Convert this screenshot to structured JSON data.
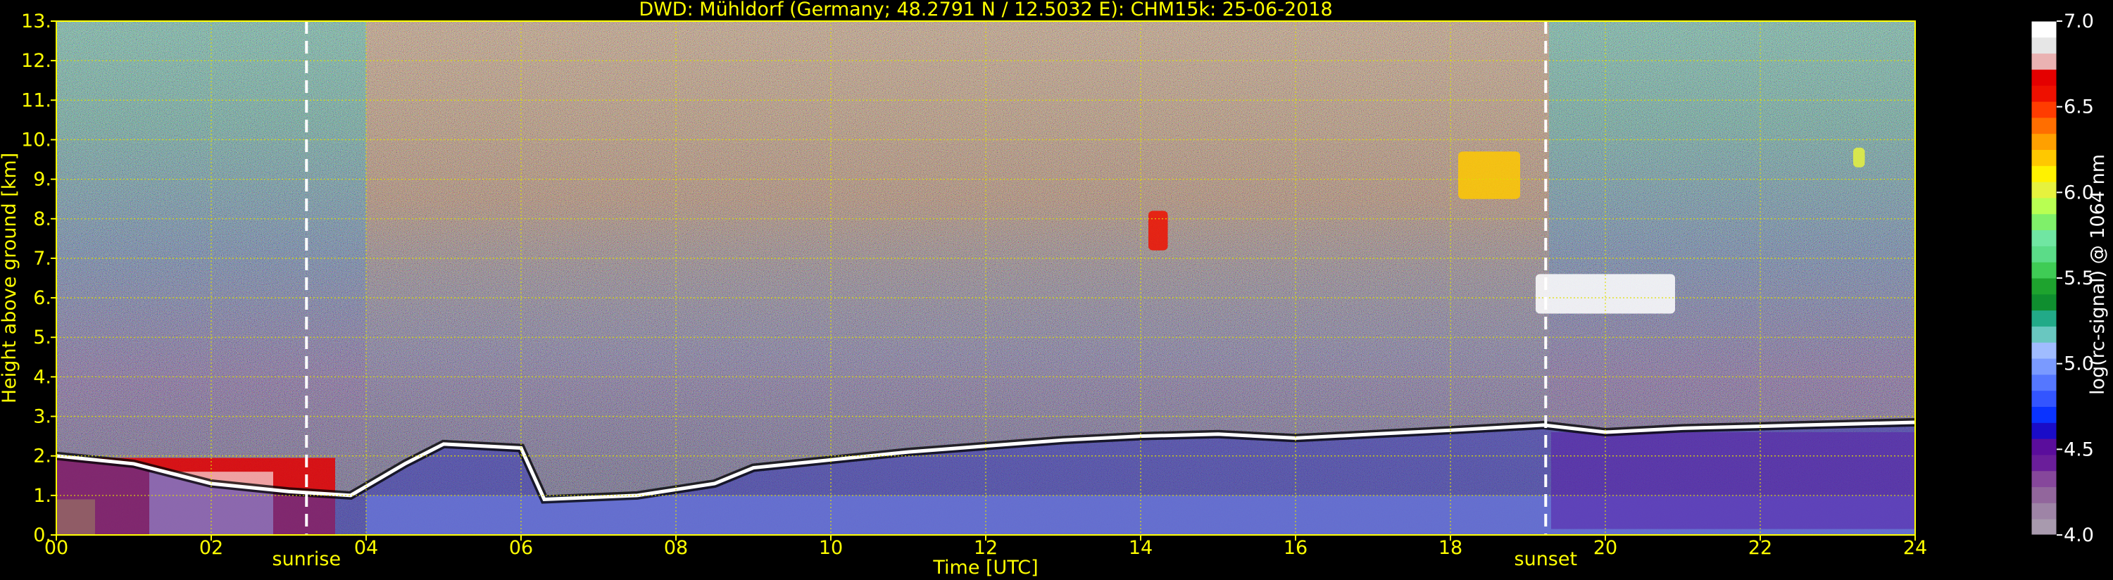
{
  "chart_data": {
    "type": "heatmap",
    "title": "DWD: Mühldorf (Germany; 48.2791 N / 12.5032 E):    CHM15k: 25-06-2018",
    "xlabel": "Time [UTC]",
    "ylabel": "Height above ground [km]",
    "xlim": [
      0,
      24
    ],
    "ylim": [
      0,
      13
    ],
    "x_ticks": [
      0,
      2,
      4,
      6,
      8,
      10,
      12,
      14,
      16,
      18,
      20,
      22,
      24
    ],
    "x_tick_labels": [
      "00",
      "02",
      "04",
      "06",
      "08",
      "10",
      "12",
      "14",
      "16",
      "18",
      "20",
      "22",
      "24"
    ],
    "y_ticks": [
      0,
      1,
      2,
      3,
      4,
      5,
      6,
      7,
      8,
      9,
      10,
      11,
      12,
      13
    ],
    "y_tick_labels": [
      "0.",
      "1.",
      "2.",
      "3.",
      "4.",
      "5.",
      "6.",
      "7.",
      "8.",
      "9.",
      "10.",
      "11.",
      "12.",
      "13."
    ],
    "grid": true,
    "annotations": [
      {
        "label": "sunrise",
        "x": 3.23
      },
      {
        "label": "sunset",
        "x": 19.23
      }
    ],
    "colorbar": {
      "label": "log(rc-signal) @ 1064 nm",
      "range": [
        4.0,
        7.0
      ],
      "ticks": [
        4.0,
        4.5,
        5.0,
        5.5,
        6.0,
        6.5,
        7.0
      ],
      "tick_labels": [
        "4.0",
        "4.5",
        "5.0",
        "5.5",
        "6.0",
        "6.5",
        "7.0"
      ],
      "colors": [
        "#a89aae",
        "#9e84a6",
        "#92669c",
        "#86479b",
        "#6a1e9a",
        "#5a0d9c",
        "#1a0cc8",
        "#0a33ff",
        "#3355ff",
        "#5577ff",
        "#7a9aff",
        "#a0bcff",
        "#69c7c0",
        "#22aa88",
        "#0f8e2f",
        "#1ea32e",
        "#3fcc55",
        "#5bdc88",
        "#70e6a2",
        "#7ff06a",
        "#b8ff52",
        "#e6f23e",
        "#fff200",
        "#ffc800",
        "#ffa000",
        "#ff6e00",
        "#ff3c00",
        "#ee1000",
        "#e40000",
        "#eab2b2",
        "#e6e6e6",
        "#ffffff"
      ]
    },
    "layers": {
      "boundary_layer_top_km": [
        [
          0,
          2.0
        ],
        [
          1,
          1.8
        ],
        [
          2,
          1.3
        ],
        [
          3,
          1.1
        ],
        [
          3.8,
          1.0
        ],
        [
          4.5,
          1.8
        ],
        [
          5,
          2.3
        ],
        [
          6,
          2.2
        ],
        [
          6.3,
          0.9
        ],
        [
          7.5,
          1.0
        ],
        [
          8.5,
          1.3
        ],
        [
          9,
          1.7
        ],
        [
          10,
          1.9
        ],
        [
          11,
          2.1
        ],
        [
          12,
          2.25
        ],
        [
          13,
          2.4
        ],
        [
          14,
          2.5
        ],
        [
          15,
          2.55
        ],
        [
          16,
          2.45
        ],
        [
          17,
          2.55
        ],
        [
          18,
          2.65
        ],
        [
          19.2,
          2.78
        ],
        [
          20,
          2.6
        ],
        [
          21,
          2.7
        ],
        [
          22,
          2.75
        ],
        [
          23,
          2.8
        ],
        [
          24,
          2.85
        ]
      ],
      "cloud_patches": [
        {
          "x": [
            19.1,
            20.9
          ],
          "y": [
            5.6,
            6.6
          ],
          "value": 7.0
        },
        {
          "x": [
            14.1,
            14.35
          ],
          "y": [
            7.2,
            8.2
          ],
          "value": 6.6
        },
        {
          "x": [
            18.1,
            18.9
          ],
          "y": [
            8.5,
            9.7
          ],
          "value": 6.2
        },
        {
          "x": [
            23.2,
            23.35
          ],
          "y": [
            9.3,
            9.8
          ],
          "value": 6.0
        }
      ],
      "aerosol_low_layer": {
        "x": [
          4.0,
          24.0
        ],
        "y": [
          0.0,
          1.0
        ],
        "value": 5.1
      },
      "strong_lower_signal": {
        "x": [
          0.0,
          3.6
        ],
        "y": [
          0.0,
          1.95
        ],
        "value": 6.7
      }
    }
  }
}
